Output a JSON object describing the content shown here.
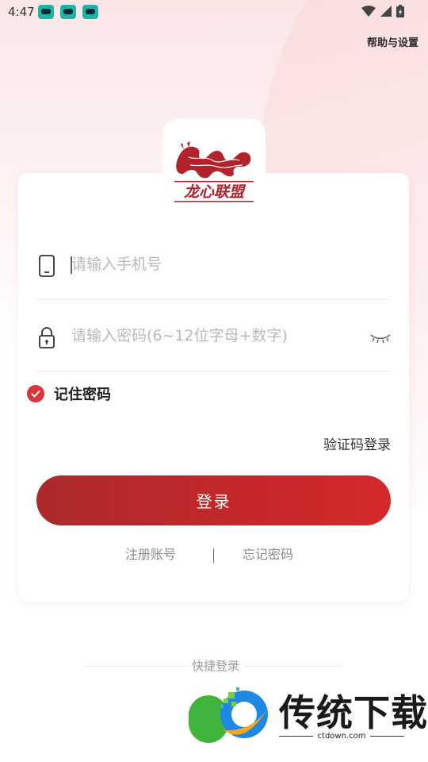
{
  "status_bar": {
    "time": "4:47"
  },
  "header": {
    "help_label": "帮助与设置"
  },
  "logo": {
    "text": "龙心联盟"
  },
  "form": {
    "phone": {
      "placeholder": "请输入手机号",
      "value": ""
    },
    "password": {
      "placeholder": "请输入密码(6~12位字母+数字)",
      "value": ""
    },
    "remember_label": "记住密码",
    "remember_checked": true,
    "sms_login_label": "验证码登录",
    "login_button": "登录",
    "register_label": "注册账号",
    "forgot_label": "忘记密码"
  },
  "quick_login": {
    "label": "快捷登录"
  },
  "watermark": {
    "title": "传统下载",
    "url": "ctdown.com"
  },
  "colors": {
    "accent": "#c82a2c",
    "check": "#d9353b",
    "wechat": "#3fb33a"
  },
  "icons": [
    "phone-icon",
    "lock-icon",
    "eye-closed-icon",
    "check-icon",
    "wifi-icon",
    "signal-icon",
    "battery-icon"
  ]
}
